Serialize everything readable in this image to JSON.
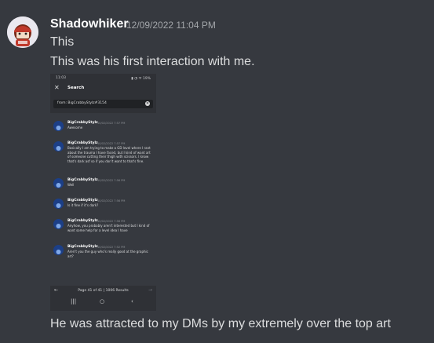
{
  "message": {
    "author": "Shadowhiker",
    "timestamp": "12/09/2022 11:04 PM",
    "lines": [
      "This",
      "This was his first interaction with me.",
      "He was attracted to my DMs by my extremely over the top art"
    ]
  },
  "attachment": {
    "status_time": "11:03",
    "status_icons": "▮ ◔ ᯤ 19%",
    "close_icon": "✕",
    "title": "Search",
    "search_value": "from: BigCrabbyStylz#3154",
    "clear_icon": "✕",
    "results": [
      {
        "name": "BigCrabbyStylz",
        "date": "10/02/2022 7:57 PM",
        "text": "Awesome"
      },
      {
        "name": "BigCrabbyStylz",
        "date": "10/02/2022 7:57 PM",
        "text": "Basically I am trying to make a GD level where I rant about the trauma I have faced, but I kind of want art of someone cutting their thigh with scissors. I know that's dark asf so if you don't want to that's fine."
      },
      {
        "name": "BigCrabbyStylz",
        "date": "10/02/2022 7:56 PM",
        "text": "Well"
      },
      {
        "name": "BigCrabbyStylz",
        "date": "10/02/2022 7:56 PM",
        "text": "Is it fine if it's dark?"
      },
      {
        "name": "BigCrabbyStylz",
        "date": "10/02/2022 7:56 PM",
        "text": "Anyhow, you probably aren't interested but I kind of want some help for a level idea I have"
      },
      {
        "name": "BigCrabbyStylz",
        "date": "10/02/2022 7:52 PM",
        "text": "Aren't you the guy who's really good at the graphic art?"
      }
    ],
    "pager": {
      "prev": "←",
      "next": "→",
      "label": "Page 41 of 41  |  1006 Results"
    },
    "nav": {
      "recents": "|||",
      "home": "○",
      "back": "‹"
    }
  },
  "colors": {
    "background": "#36393f",
    "author": "#ffffff",
    "timestamp": "#a3a6aa",
    "text": "#dcddde"
  }
}
